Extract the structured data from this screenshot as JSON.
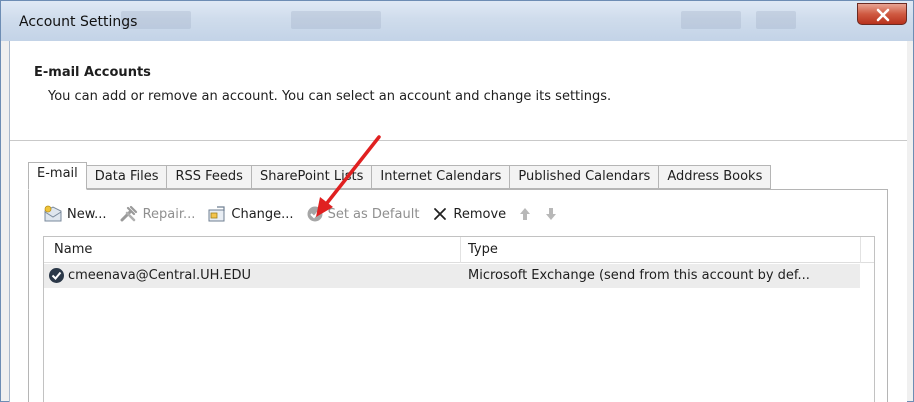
{
  "window": {
    "title": "Account Settings"
  },
  "header": {
    "title": "E-mail Accounts",
    "description": "You can add or remove an account. You can select an account and change its settings."
  },
  "tabs": [
    {
      "label": "E-mail",
      "active": true
    },
    {
      "label": "Data Files"
    },
    {
      "label": "RSS Feeds"
    },
    {
      "label": "SharePoint Lists"
    },
    {
      "label": "Internet Calendars"
    },
    {
      "label": "Published Calendars"
    },
    {
      "label": "Address Books"
    }
  ],
  "toolbar": {
    "new_label": "New...",
    "repair_label": "Repair...",
    "change_label": "Change...",
    "set_default_label": "Set as Default",
    "remove_label": "Remove"
  },
  "list": {
    "columns": [
      "Name",
      "Type"
    ],
    "rows": [
      {
        "name": "cmeenava@Central.UH.EDU",
        "type": "Microsoft Exchange (send from this account by def..."
      }
    ]
  },
  "colors": {
    "annotation_arrow": "#e02020",
    "close_button": "#c94a35"
  }
}
